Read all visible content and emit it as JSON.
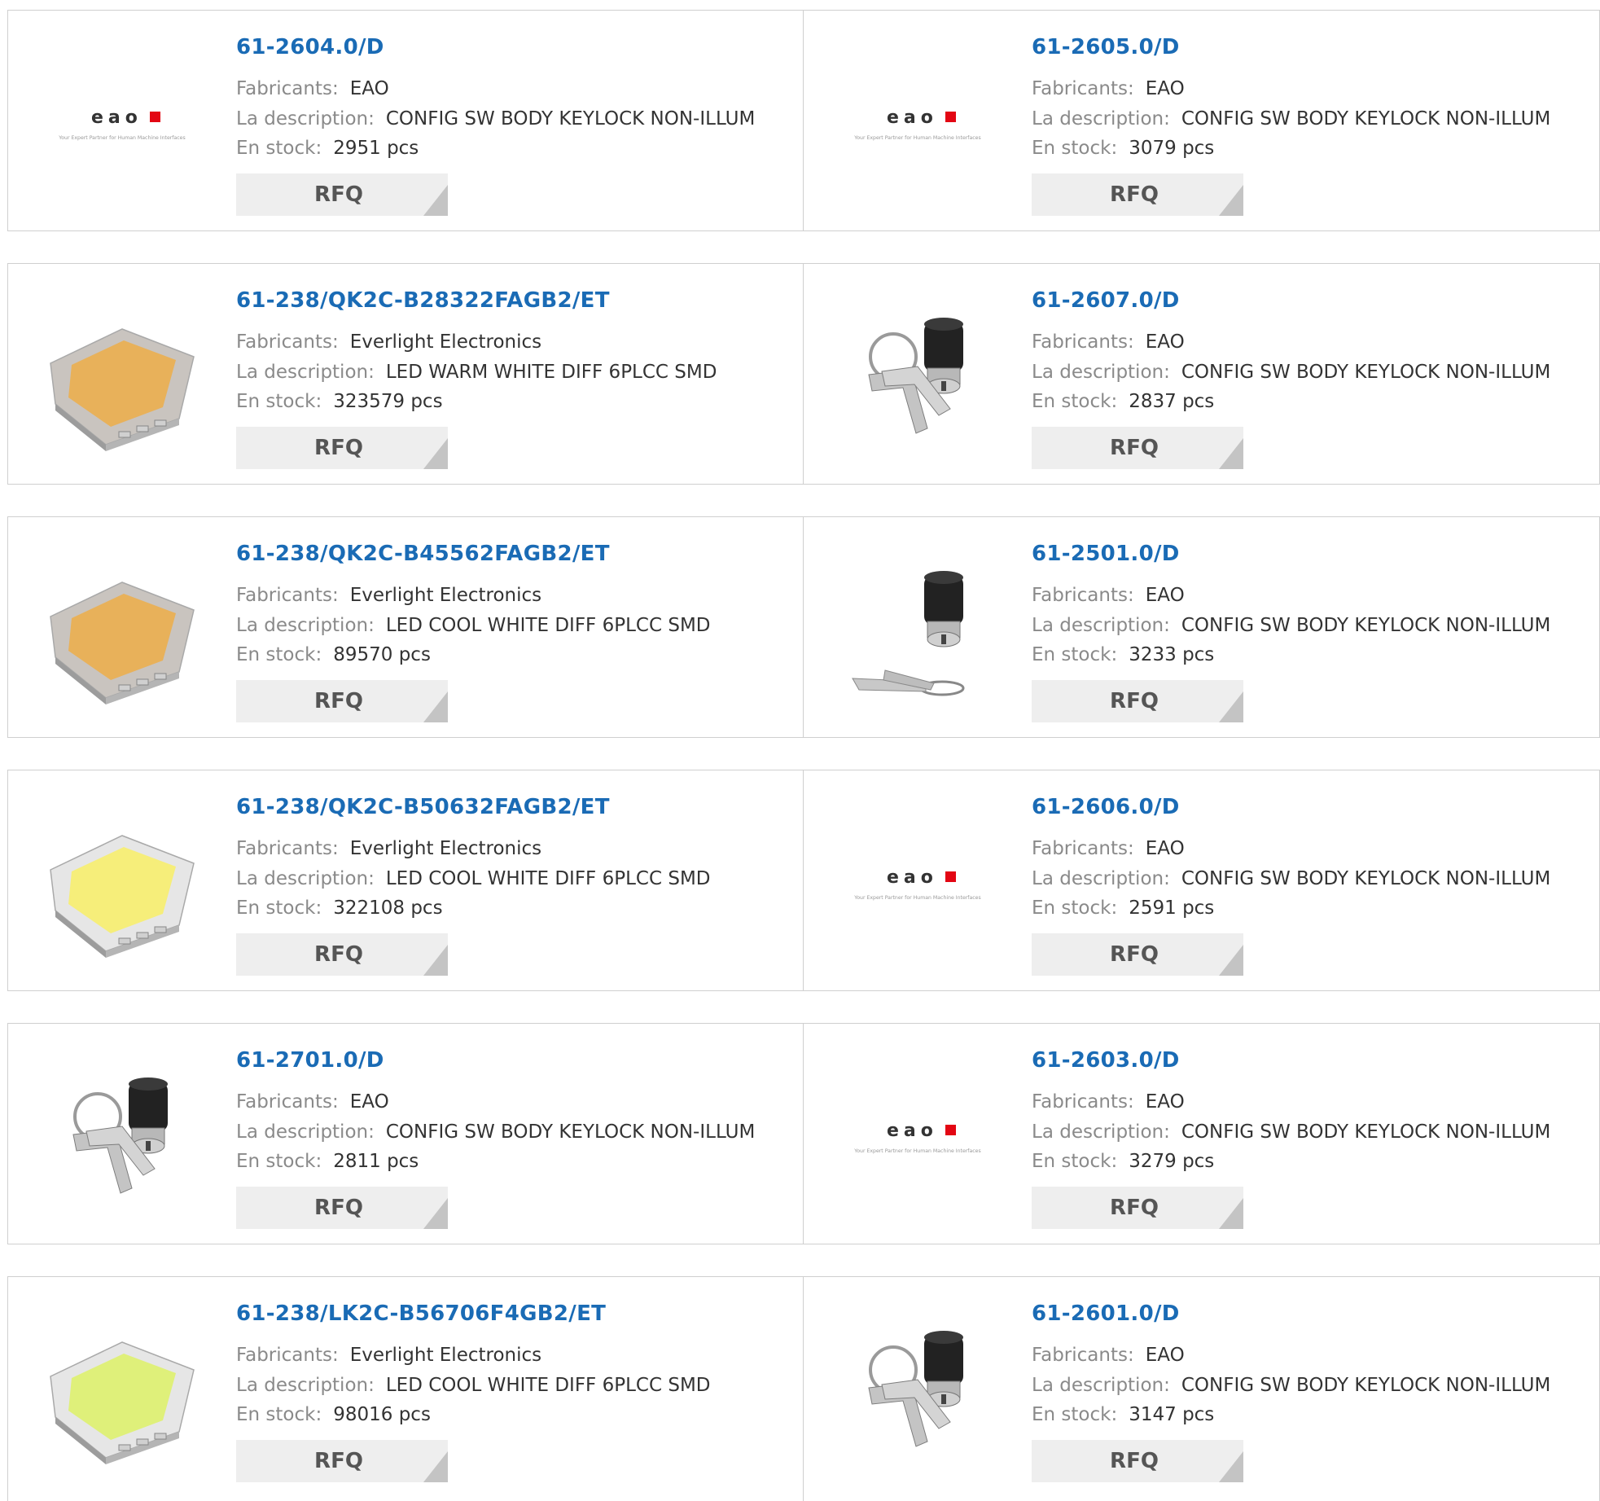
{
  "labels": {
    "manufacturer": "Fabricants:",
    "description": "La description:",
    "stock": "En stock:",
    "rfq": "RFQ"
  },
  "logo": {
    "brand": "eao",
    "tagline": "Your Expert Partner for Human Machine Interfaces",
    "accent_color": "#e30613"
  },
  "colors": {
    "title": "#1a6bb5",
    "label": "#8a8a8a",
    "value": "#333333",
    "rfq_bg": "#eeeeee"
  },
  "products": [
    {
      "part": "61-2604.0/D",
      "manufacturer": "EAO",
      "description": "CONFIG SW BODY KEYLOCK NON-ILLUM",
      "stock": "2951 pcs",
      "image": "eao-logo"
    },
    {
      "part": "61-2605.0/D",
      "manufacturer": "EAO",
      "description": "CONFIG SW BODY KEYLOCK NON-ILLUM",
      "stock": "3079 pcs",
      "image": "eao-logo"
    },
    {
      "part": "61-238/QK2C-B28322FAGB2/ET",
      "manufacturer": "Everlight Electronics",
      "description": "LED WARM WHITE DIFF 6PLCC SMD",
      "stock": "323579 pcs",
      "image": "led-amber"
    },
    {
      "part": "61-2607.0/D",
      "manufacturer": "EAO",
      "description": "CONFIG SW BODY KEYLOCK NON-ILLUM",
      "stock": "2837 pcs",
      "image": "keylock-ring"
    },
    {
      "part": "61-238/QK2C-B45562FAGB2/ET",
      "manufacturer": "Everlight Electronics",
      "description": "LED COOL WHITE DIFF 6PLCC SMD",
      "stock": "89570 pcs",
      "image": "led-amber"
    },
    {
      "part": "61-2501.0/D",
      "manufacturer": "EAO",
      "description": "CONFIG SW BODY KEYLOCK NON-ILLUM",
      "stock": "3233 pcs",
      "image": "keylock-flat"
    },
    {
      "part": "61-238/QK2C-B50632FAGB2/ET",
      "manufacturer": "Everlight Electronics",
      "description": "LED COOL WHITE DIFF 6PLCC SMD",
      "stock": "322108 pcs",
      "image": "led-yellow"
    },
    {
      "part": "61-2606.0/D",
      "manufacturer": "EAO",
      "description": "CONFIG SW BODY KEYLOCK NON-ILLUM",
      "stock": "2591 pcs",
      "image": "eao-logo"
    },
    {
      "part": "61-2701.0/D",
      "manufacturer": "EAO",
      "description": "CONFIG SW BODY KEYLOCK NON-ILLUM",
      "stock": "2811 pcs",
      "image": "keylock-ring"
    },
    {
      "part": "61-2603.0/D",
      "manufacturer": "EAO",
      "description": "CONFIG SW BODY KEYLOCK NON-ILLUM",
      "stock": "3279 pcs",
      "image": "eao-logo"
    },
    {
      "part": "61-238/LK2C-B56706F4GB2/ET",
      "manufacturer": "Everlight Electronics",
      "description": "LED COOL WHITE DIFF 6PLCC SMD",
      "stock": "98016 pcs",
      "image": "led-lime"
    },
    {
      "part": "61-2601.0/D",
      "manufacturer": "EAO",
      "description": "CONFIG SW BODY KEYLOCK NON-ILLUM",
      "stock": "3147 pcs",
      "image": "keylock-ring"
    }
  ]
}
